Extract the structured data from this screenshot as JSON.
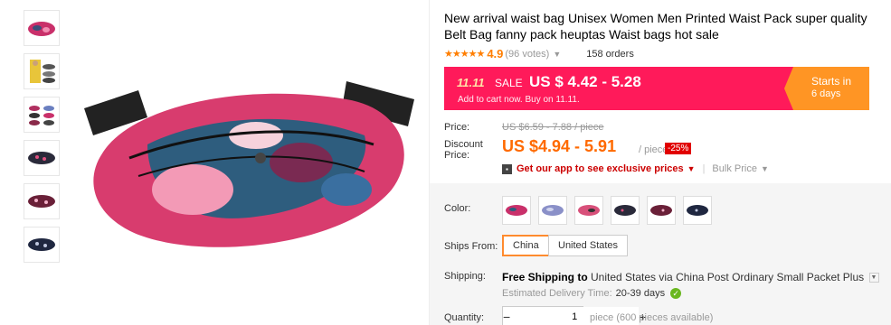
{
  "product": {
    "title": "New arrival waist bag Unisex Women Men Printed Waist Pack super quality Belt Bag fanny pack heuptas Waist bags hot sale",
    "stars": "★★★★★",
    "rating": "4.9",
    "votes": "(96 votes)",
    "orders": "158 orders"
  },
  "promo": {
    "tag": "11.11",
    "sale_label": "SALE",
    "price_range": "US $ 4.42 - 5.28",
    "note": "Add to cart now. Buy on 11.11.",
    "starts_label": "Starts in",
    "starts_value": "6 days"
  },
  "pricing": {
    "price_label": "Price:",
    "original_price": "US $6.59 - 7.88 / piece",
    "discount_label_1": "Discount",
    "discount_label_2": "Price:",
    "discount_price": "US $4.94 - 5.91",
    "per_piece": "/ piece",
    "discount_badge": "-25%",
    "app_link": "Get our app to see exclusive prices",
    "bulk_price": "Bulk Price"
  },
  "options": {
    "color_label": "Color:",
    "ships_from_label": "Ships From:",
    "ships_from": [
      "China",
      "United States"
    ],
    "selected_ship_from": "China"
  },
  "shipping": {
    "label": "Shipping:",
    "free_shipping": "Free Shipping to",
    "destination_text": "United States via China Post Ordinary Small Packet Plus",
    "est_label": "Estimated Delivery Time:",
    "est_days": "20-39 days"
  },
  "quantity": {
    "label": "Quantity:",
    "value": "1",
    "minus": "−",
    "plus": "+",
    "note": "piece (600 pieces available)"
  },
  "colors": {
    "promo_bg": "#ff1a5a",
    "starts_bg": "#ff9524",
    "price": "#ff6a00",
    "badge": "#e10000"
  }
}
